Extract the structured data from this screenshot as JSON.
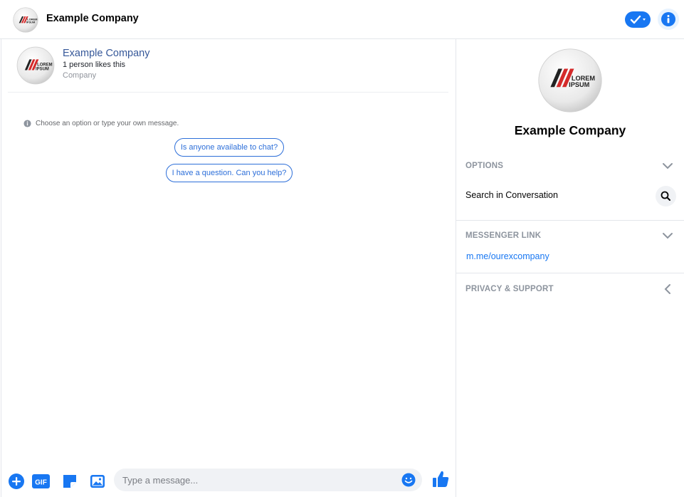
{
  "header": {
    "title": "Example Company"
  },
  "page_card": {
    "name": "Example Company",
    "likes": "1 person likes this",
    "category": "Company"
  },
  "logo": {
    "line1": "LOREM",
    "line2": "IPSUM"
  },
  "conversation": {
    "hint": "Choose an option or type your own message.",
    "quick_replies": [
      "Is anyone available to chat?",
      "I have a question. Can you help?"
    ]
  },
  "composer": {
    "placeholder": "Type a message...",
    "gif_label": "GIF"
  },
  "sidebar": {
    "title": "Example Company",
    "options": {
      "heading": "OPTIONS",
      "search_label": "Search in Conversation"
    },
    "messenger_link": {
      "heading": "MESSENGER LINK",
      "url": "m.me/ourexcompany"
    },
    "privacy": {
      "heading": "PRIVACY & SUPPORT"
    }
  },
  "colors": {
    "accent": "#1877f2",
    "link_blue": "#365899",
    "muted": "#8d949e"
  }
}
